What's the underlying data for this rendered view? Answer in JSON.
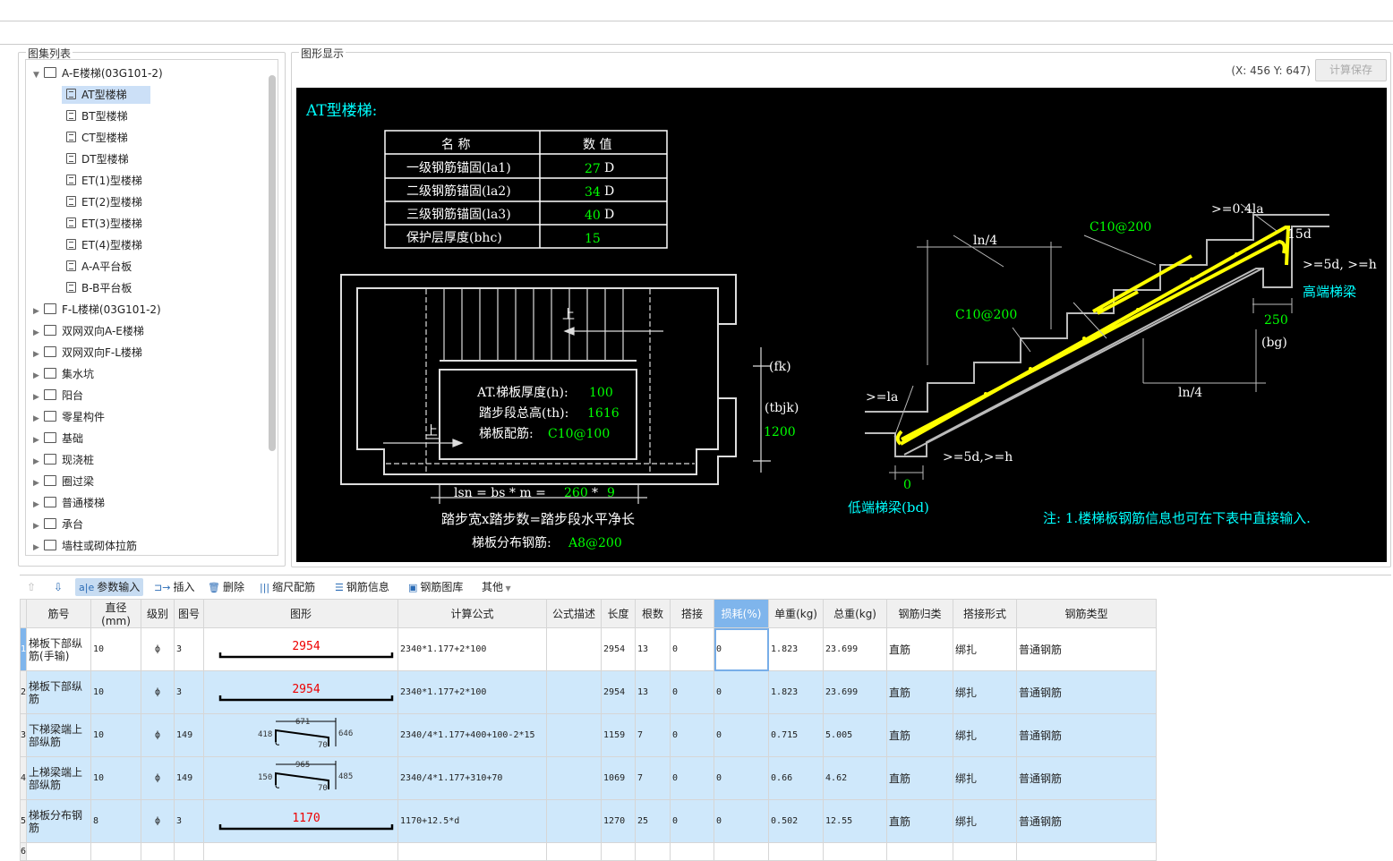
{
  "left_panel": {
    "title": "图集列表",
    "tree": [
      {
        "label": "A-E楼梯(03G101-2)",
        "expanded": true,
        "children": [
          "AT型楼梯",
          "BT型楼梯",
          "CT型楼梯",
          "DT型楼梯",
          "ET(1)型楼梯",
          "ET(2)型楼梯",
          "ET(3)型楼梯",
          "ET(4)型楼梯",
          "A-A平台板",
          "B-B平台板"
        ],
        "selected": "AT型楼梯"
      },
      {
        "label": "F-L楼梯(03G101-2)"
      },
      {
        "label": "双网双向A-E楼梯"
      },
      {
        "label": "双网双向F-L楼梯"
      },
      {
        "label": "集水坑"
      },
      {
        "label": "阳台"
      },
      {
        "label": "零星构件"
      },
      {
        "label": "基础"
      },
      {
        "label": "现浇桩"
      },
      {
        "label": "圈过梁"
      },
      {
        "label": "普通楼梯"
      },
      {
        "label": "承台"
      },
      {
        "label": "墙柱或砌体拉筋"
      }
    ]
  },
  "right_panel": {
    "title": "图形显示",
    "coord": "(X: 456 Y: 647)",
    "save_button": "计算保存"
  },
  "drawing": {
    "title": "AT型楼梯:",
    "param_table": {
      "headers": [
        "名  称",
        "数  值"
      ],
      "rows": [
        [
          "一级钢筋锚固(la1)",
          "27",
          "D"
        ],
        [
          "二级钢筋锚固(la2)",
          "34",
          "D"
        ],
        [
          "三级钢筋锚固(la3)",
          "40",
          "D"
        ],
        [
          "保护层厚度(bhc)",
          "15",
          ""
        ]
      ]
    },
    "plan": {
      "up1": "上",
      "up2": "上",
      "fk": "(fk)",
      "tbjk": "(tbjk)",
      "tbjk_val": "1200",
      "h_label": "AT.梯板厚度(h):",
      "h_val": "100",
      "th_label": "踏步段总高(th):",
      "th_val": "1616",
      "pj_label": "梯板配筋:",
      "pj_val": "C10@100",
      "lsn_label": "lsn = bs * m =",
      "bs_val": "260",
      "m_sep": "*",
      "m_val": "9",
      "desc": "踏步宽x踏步数=踏步段水平净长",
      "dist_label": "梯板分布钢筋:",
      "dist_val": "A8@200"
    },
    "section": {
      "ln4a": "ln/4",
      "ln4b": "ln/4",
      "c10a": "C10@200",
      "c10b": "C10@200",
      "la04": ">=0.4la",
      "d15": "15d",
      "d5h_hi": ">=5d, >=h",
      "high_beam": "高端梯梁",
      "bg_val": "250",
      "bg": "(bg)",
      "la": ">=la",
      "d5h_lo": ">=5d,>=h",
      "bd_val": "0",
      "low_beam": "低端梯梁(bd)",
      "note": "注: 1.楼梯板钢筋信息也可在下表中直接输入."
    }
  },
  "toolbar": [
    "参数输入",
    "插入",
    "删除",
    "缩尺配筋",
    "钢筋信息",
    "钢筋图库",
    "其他"
  ],
  "grid": {
    "headers": [
      "筋号",
      "直径(mm)",
      "级别",
      "图号",
      "图形",
      "计算公式",
      "公式描述",
      "长度",
      "根数",
      "搭接",
      "损耗(%)",
      "单重(kg)",
      "总重(kg)",
      "钢筋归类",
      "搭接形式",
      "钢筋类型"
    ],
    "rows": [
      {
        "n": "1",
        "name": "梯板下部纵筋(手输)",
        "d": "10",
        "grade": "ф",
        "fig": "3",
        "shape": {
          "type": "straight",
          "len": "2954"
        },
        "formula": "2340*1.177+2*100",
        "desc": "",
        "length": "2954",
        "count": "13",
        "lap": "0",
        "loss": "0",
        "unit": "1.823",
        "total": "23.699",
        "cls": "直筋",
        "lapform": "绑扎",
        "type": "普通钢筋"
      },
      {
        "n": "2",
        "name": "梯板下部纵筋",
        "d": "10",
        "grade": "ф",
        "fig": "3",
        "shape": {
          "type": "straight",
          "len": "2954"
        },
        "formula": "2340*1.177+2*100",
        "desc": "",
        "length": "2954",
        "count": "13",
        "lap": "0",
        "loss": "0",
        "unit": "1.823",
        "total": "23.699",
        "cls": "直筋",
        "lapform": "绑扎",
        "type": "普通钢筋"
      },
      {
        "n": "3",
        "name": "下梯梁端上部纵筋",
        "d": "10",
        "grade": "ф",
        "fig": "149",
        "shape": {
          "type": "bent",
          "top": "671",
          "left": "418",
          "right": "646",
          "down": "70"
        },
        "formula": "2340/4*1.177+400+100-2*15",
        "desc": "",
        "length": "1159",
        "count": "7",
        "lap": "0",
        "loss": "0",
        "unit": "0.715",
        "total": "5.005",
        "cls": "直筋",
        "lapform": "绑扎",
        "type": "普通钢筋"
      },
      {
        "n": "4",
        "name": "上梯梁端上部纵筋",
        "d": "10",
        "grade": "ф",
        "fig": "149",
        "shape": {
          "type": "bent",
          "top": "965",
          "left": "150",
          "right": "485",
          "down": "70"
        },
        "formula": "2340/4*1.177+310+70",
        "desc": "",
        "length": "1069",
        "count": "7",
        "lap": "0",
        "loss": "0",
        "unit": "0.66",
        "total": "4.62",
        "cls": "直筋",
        "lapform": "绑扎",
        "type": "普通钢筋"
      },
      {
        "n": "5",
        "name": "梯板分布钢筋",
        "d": "8",
        "grade": "ф",
        "fig": "3",
        "shape": {
          "type": "straight",
          "len": "1170"
        },
        "formula": "1170+12.5*d",
        "desc": "",
        "length": "1270",
        "count": "25",
        "lap": "0",
        "loss": "0",
        "unit": "0.502",
        "total": "12.55",
        "cls": "直筋",
        "lapform": "绑扎",
        "type": "普通钢筋"
      }
    ],
    "empty_row": "6"
  },
  "colors": {
    "cyan": "#00ffff",
    "green": "#00ff00",
    "yellow": "#ffff00",
    "select": "#cfe8fb",
    "accent": "#7fb5ec"
  }
}
